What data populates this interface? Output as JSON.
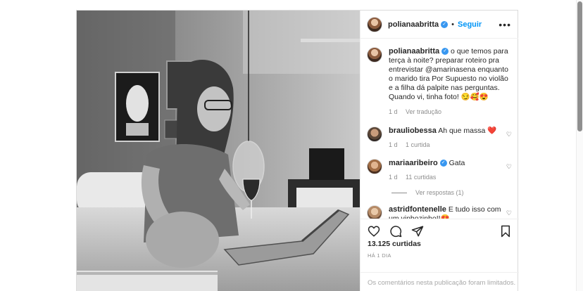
{
  "post": {
    "author": "polianaabritta",
    "follow_label": "Seguir",
    "more_label": "•••",
    "caption": {
      "author": "polianaabritta",
      "text": "o que temos para terça à noite? preparar roteiro pra entrevistar @amarinasena enquanto o marido tira Por Supuesto no violão e a filha dá palpite nas perguntas. Quando vi, tinha foto! 😏🥰😍",
      "time": "1 d",
      "translate_label": "Ver tradução"
    },
    "comments": [
      {
        "author": "brauliobessa",
        "text": "Ah que massa ❤️",
        "time": "1 d",
        "likes": "1 curtida"
      },
      {
        "author": "mariaaribeiro",
        "text": "Gata",
        "time": "1 d",
        "likes": "11 curtidas",
        "replies_label": "Ver respostas (1)"
      },
      {
        "author": "astridfontenelle",
        "text": "E tudo isso com um vinhozinho!!😍"
      }
    ],
    "likes_count": "13.125 curtidas",
    "posted_ago": "HÁ 1 DIA",
    "comments_limited": "Os comentários nesta publicação foram limitados."
  },
  "icons": {
    "verified": "verified-badge-icon",
    "like": "heart-icon",
    "comment": "comment-bubble-icon",
    "share": "paper-plane-icon",
    "save": "bookmark-icon"
  },
  "colors": {
    "accent": "#0095f6",
    "verified": "#3897f0",
    "heart": "#ed4956"
  }
}
